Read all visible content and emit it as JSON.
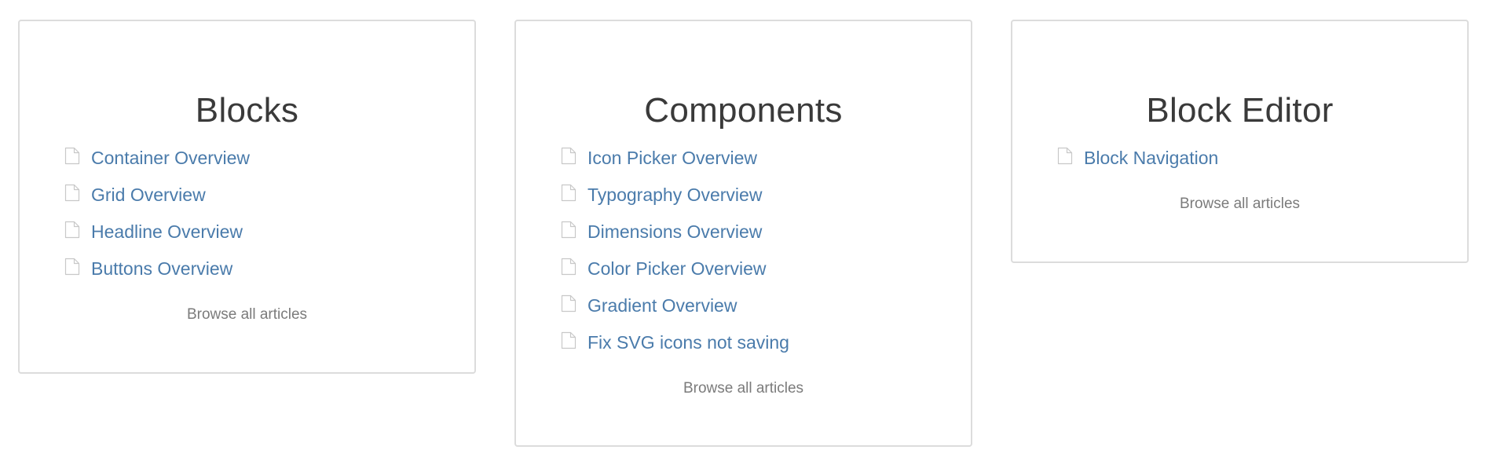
{
  "categories": [
    {
      "title": "Blocks",
      "articles": [
        "Container Overview",
        "Grid Overview",
        "Headline Overview",
        "Buttons Overview"
      ],
      "browse_label": "Browse all articles"
    },
    {
      "title": "Components",
      "articles": [
        "Icon Picker Overview",
        "Typography Overview",
        "Dimensions Overview",
        "Color Picker Overview",
        "Gradient Overview",
        "Fix SVG icons not saving"
      ],
      "browse_label": "Browse all articles"
    },
    {
      "title": "Block Editor",
      "articles": [
        "Block Navigation"
      ],
      "browse_label": "Browse all articles"
    }
  ],
  "icons": {
    "article": "document-icon"
  },
  "colors": {
    "link": "#4a7bab",
    "title": "#3a3a3a",
    "browse": "#7b7b7b",
    "border": "#dcdcdc",
    "icon": "#c8c8c8"
  }
}
